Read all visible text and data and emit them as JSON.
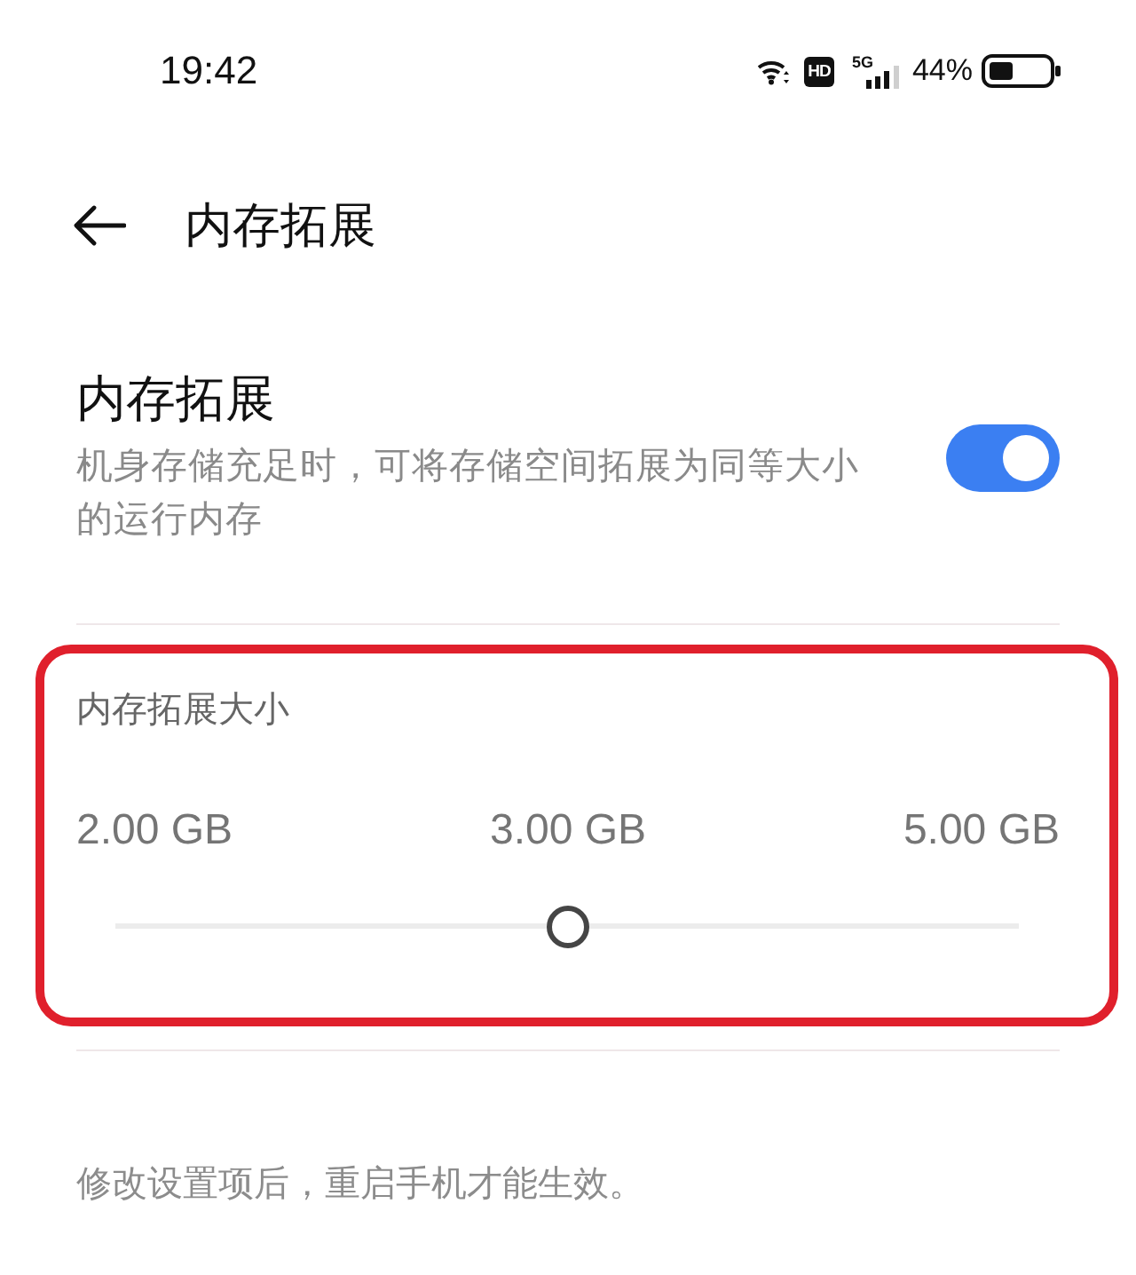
{
  "status_bar": {
    "time": "19:42",
    "hd_badge": "HD",
    "network": "5G",
    "battery": "44%"
  },
  "header": {
    "title": "内存拓展"
  },
  "feature": {
    "title": "内存拓展",
    "description": "机身存储充足时，可将存储空间拓展为同等大小的运行内存",
    "on": true
  },
  "size": {
    "highlighted": true,
    "title": "内存拓展大小",
    "labels": [
      "2.00 GB",
      "3.00 GB",
      "5.00 GB"
    ],
    "level": 0.5
  },
  "note": "修改设置项后，重启手机才能生效。"
}
